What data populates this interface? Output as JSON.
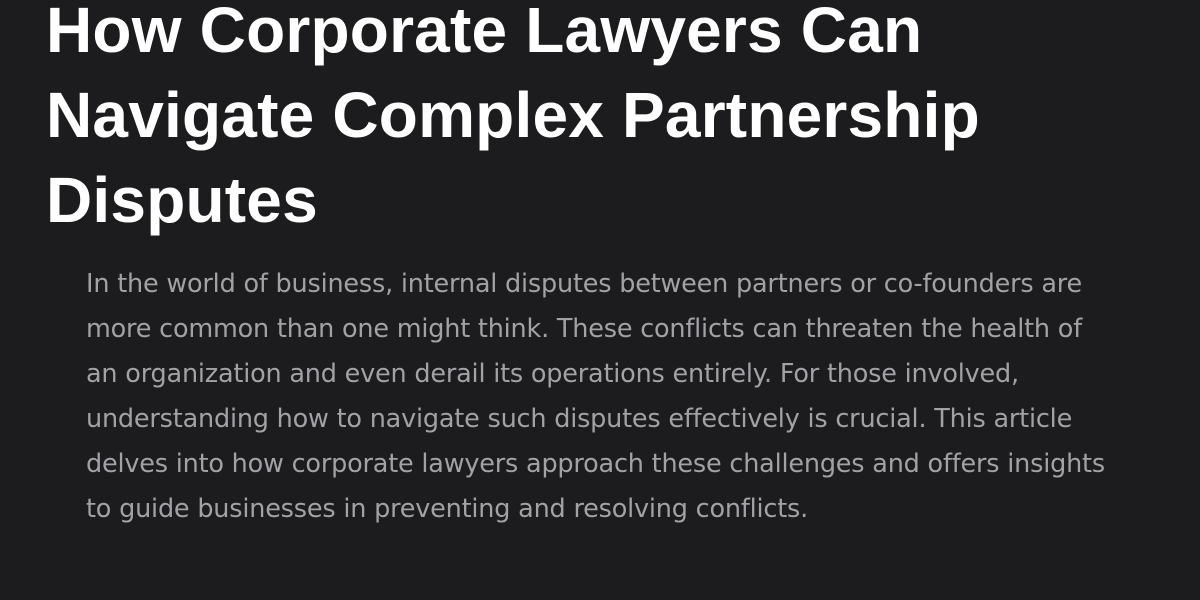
{
  "article": {
    "title": "How Corporate Lawyers Can Navigate Complex Partnership Disputes",
    "intro": "In the world of business, internal disputes between partners or co-founders are more common than one might think. These conflicts can threaten the health of an organization and even derail its operations entirely. For those involved, understanding how to navigate such disputes effectively is crucial. This article delves into how corporate lawyers approach these challenges and offers insights to guide businesses in preventing and resolving conflicts."
  },
  "colors": {
    "background": "#1c1c1e",
    "title": "#ffffff",
    "body_text": "#a1a1a6"
  }
}
